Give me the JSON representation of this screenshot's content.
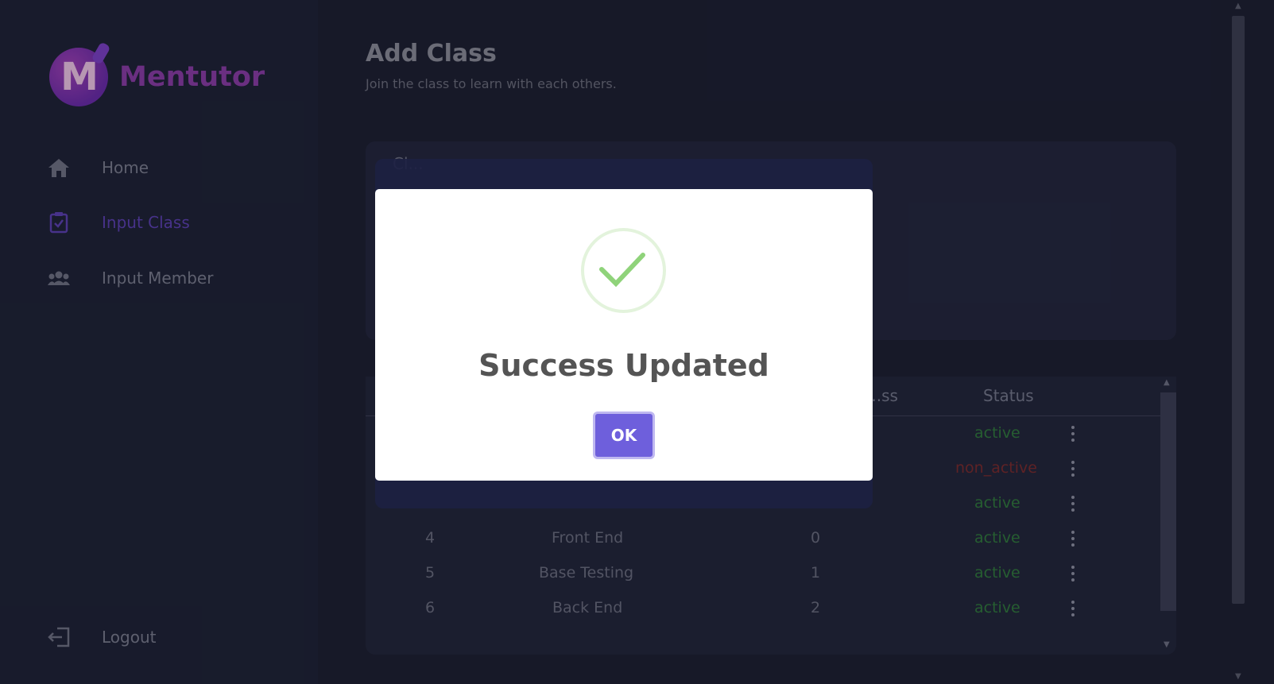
{
  "sidebar": {
    "brand_letter": "M",
    "brand_name": "Mentutor",
    "items": [
      {
        "label": "Home",
        "icon": "home-icon"
      },
      {
        "label": "Input Class",
        "icon": "clipboard-check-icon",
        "active": true
      },
      {
        "label": "Input Member",
        "icon": "users-icon"
      }
    ],
    "logout_label": "Logout"
  },
  "main": {
    "title": "Add Class",
    "subtitle": "Join the class to learn with each others.",
    "form_label": "Cl...",
    "table": {
      "headers": [
        "...ss",
        "Status"
      ],
      "rows": [
        {
          "no": "",
          "name": "",
          "count": "",
          "status": "active"
        },
        {
          "no": "",
          "name": "",
          "count": "",
          "status": "non_active"
        },
        {
          "no": "",
          "name": "",
          "count": "",
          "status": "active"
        },
        {
          "no": "4",
          "name": "Front End",
          "count": "0",
          "status": "active"
        },
        {
          "no": "5",
          "name": "Base Testing",
          "count": "1",
          "status": "active"
        },
        {
          "no": "6",
          "name": "Back End",
          "count": "2",
          "status": "active"
        }
      ]
    }
  },
  "modal": {
    "title": "Success Updated",
    "ok_label": "OK",
    "icon": "checkmark-icon"
  },
  "colors": {
    "accent": "#6e5fdc",
    "active_status": "#2f7a3a",
    "non_active_status": "#7a2a2a",
    "brand": "#8a3ba5"
  }
}
